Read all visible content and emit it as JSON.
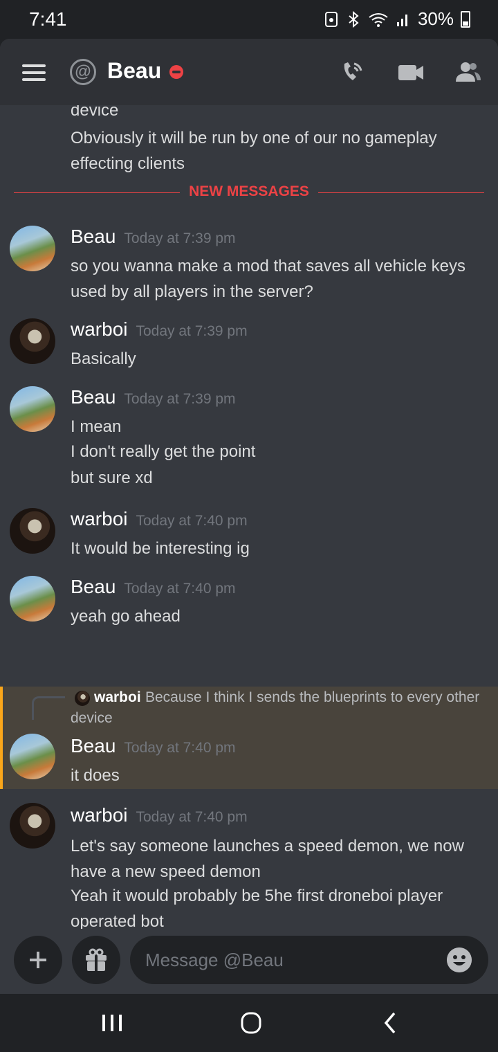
{
  "status_bar": {
    "time": "7:41",
    "battery": "30%",
    "icons": [
      "security-icon",
      "bluetooth-icon",
      "wifi-icon",
      "signal-icon",
      "battery-icon"
    ]
  },
  "header": {
    "channel_name": "Beau",
    "status": "do-not-disturb",
    "icons": [
      "menu-icon",
      "at-icon",
      "call-icon",
      "video-icon",
      "members-icon"
    ]
  },
  "previous_message": {
    "lines": [
      "device",
      "Obviously it will be run by one of our no gameplay",
      "effecting clients"
    ]
  },
  "divider": {
    "label": "NEW MESSAGES"
  },
  "messages": [
    {
      "author": "Beau",
      "timestamp": "Today at 7:39 pm",
      "lines": [
        "so you wanna make a mod that saves all vehicle keys",
        "used by all players in the server?"
      ]
    },
    {
      "author": "warboi",
      "timestamp": "Today at 7:39 pm",
      "lines": [
        "Basically"
      ]
    },
    {
      "author": "Beau",
      "timestamp": "Today at 7:39 pm",
      "lines": [
        "I mean",
        "I don't really get the point",
        "but sure xd"
      ]
    },
    {
      "author": "warboi",
      "timestamp": "Today at 7:40 pm",
      "lines": [
        "It would be interesting ig"
      ]
    },
    {
      "author": "Beau",
      "timestamp": "Today at 7:40 pm",
      "lines": [
        "yeah go ahead"
      ]
    },
    {
      "author": "Beau",
      "timestamp": "Today at 7:40 pm",
      "lines": [
        "it does"
      ],
      "reply": {
        "author": "warboi",
        "text": "Because I think I sends the blueprints to every other",
        "text_cont": "device"
      }
    },
    {
      "author": "warboi",
      "timestamp": "Today at 7:40 pm",
      "lines": [
        "Let's say someone launches a speed demon, we now",
        "have a new speed demon",
        "Yeah it would probably be 5he first droneboi player",
        "operated bot"
      ]
    }
  ],
  "composer": {
    "placeholder": "Message @Beau"
  },
  "colors": {
    "accent_red": "#ed4245",
    "reply_highlight": "#faa61a",
    "background": "#36393f"
  }
}
